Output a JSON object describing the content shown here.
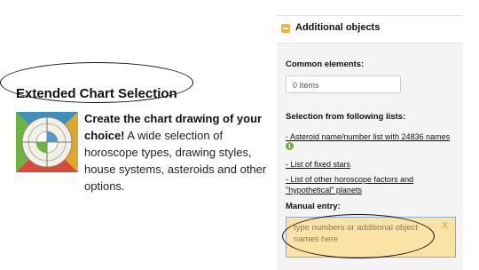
{
  "promo": {
    "heading": "Extended Chart Selection",
    "bold": "Create the chart drawing of your choice!",
    "text": " A wide selection of horoscope types, drawing styles, house systems, asteroids and other options."
  },
  "panel": {
    "title": "Additional objects",
    "common_label": "Common elements:",
    "items_value": "0 Items",
    "selection_label": "Selection from following lists:",
    "links": [
      "- Asteroid name/number list with 24836 names",
      "- List of fixed stars",
      "- List of other horoscope factors and",
      "\"hypothetical\" planets"
    ],
    "info_glyph": "i",
    "manual_label": "Manual entry:",
    "manual_placeholder": "type numbers or additional object names here",
    "clear_glyph": "X"
  },
  "colors": {
    "accent": "#f2b434",
    "manual_bg": "#fbe3a6",
    "panel_bg": "#f4f4f4",
    "info": "#6fae3a"
  }
}
